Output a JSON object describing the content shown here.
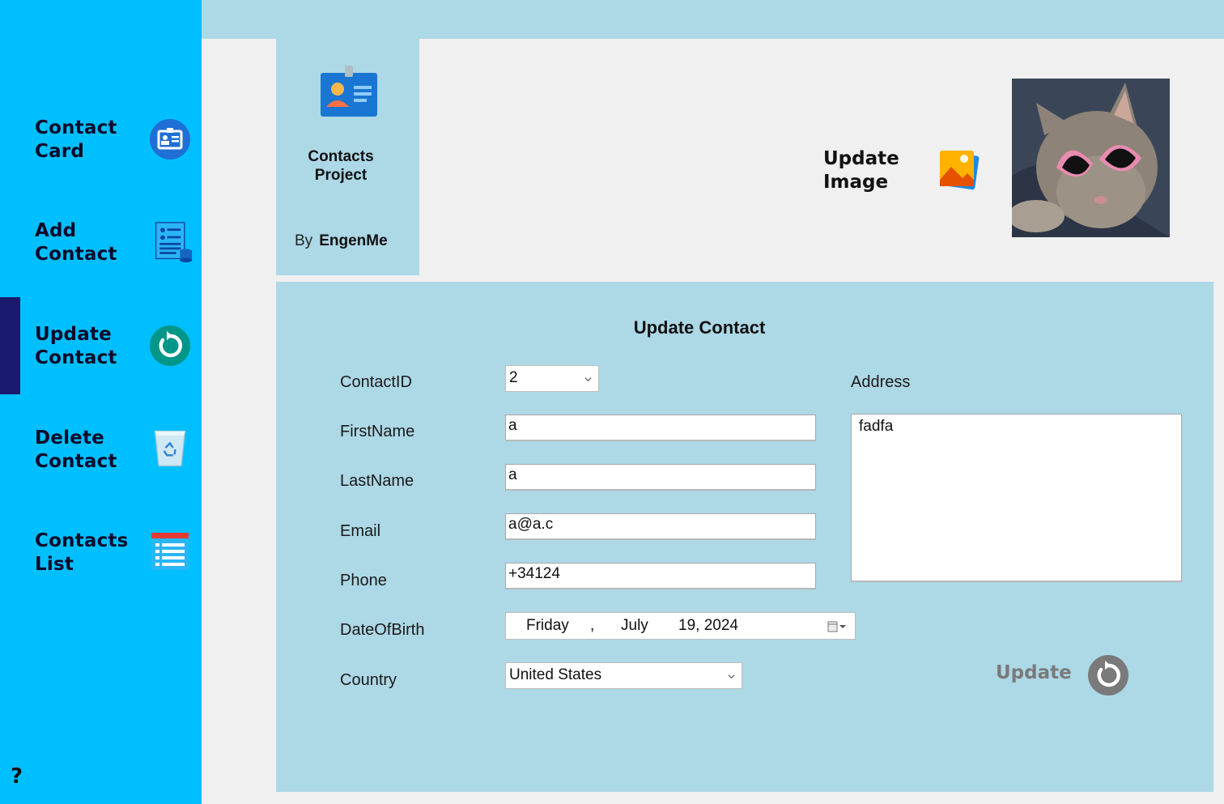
{
  "colors": {
    "sidebar_bg": "#00bfff",
    "panel_bg": "#add8e6",
    "content_bg": "#f0f0f0",
    "active_indicator": "#1a1a6e",
    "update_button_gray": "#7a7a7a"
  },
  "sidebar": {
    "items": [
      {
        "label": "Contact\nCard",
        "icon": "contact-card-icon"
      },
      {
        "label": "Add\nContact",
        "icon": "add-contact-icon"
      },
      {
        "label": "Update\nContact",
        "icon": "refresh-icon"
      },
      {
        "label": "Delete\nContact",
        "icon": "recycle-bin-icon"
      },
      {
        "label": "Contacts\nList",
        "icon": "list-icon"
      }
    ],
    "active_index": 2,
    "help_label": "?"
  },
  "project": {
    "title": "Contacts\nProject",
    "by_label": "By",
    "author": "EngenMe",
    "logo_icon": "id-badge-icon"
  },
  "update_image": {
    "label": "Update\nImage",
    "icon": "image-icon"
  },
  "form": {
    "title": "Update Contact",
    "labels": {
      "contact_id": "ContactID",
      "first_name": "FirstName",
      "last_name": "LastName",
      "email": "Email",
      "phone": "Phone",
      "dob": "DateOfBirth",
      "country": "Country",
      "address": "Address"
    },
    "values": {
      "contact_id": "2",
      "first_name": "a",
      "last_name": "a",
      "email": "a@a.c",
      "phone": "+34124",
      "dob_weekday": "Friday",
      "dob_sep": ",",
      "dob_month": "July",
      "dob_day_year": "19, 2024",
      "country": "United States",
      "address": "fadfa"
    },
    "update_button": "Update"
  }
}
